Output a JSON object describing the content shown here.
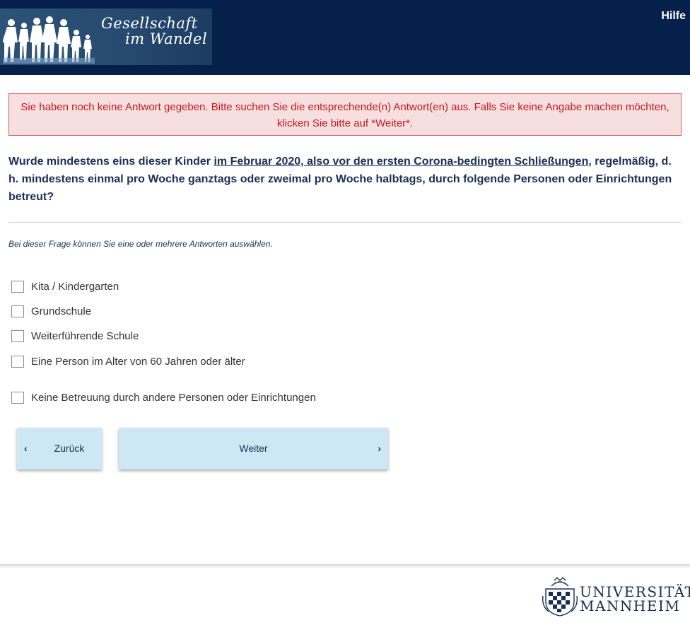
{
  "header": {
    "logo_line1": "Gesellschaft",
    "logo_line2": "im Wandel",
    "help_label": "Hilfe"
  },
  "alert": {
    "message": "Sie haben noch keine Antwort gegeben. Bitte suchen Sie die entsprechende(n) Antwort(en) aus. Falls Sie keine Angabe machen möchten, klicken Sie bitte auf *Weiter*."
  },
  "question": {
    "text_before": "Wurde mindestens eins dieser Kinder ",
    "text_underlined": "im Februar 2020, also vor den ersten Corona-bedingten Schließungen",
    "text_after": ", regelmäßig, d. h. mindestens einmal pro Woche ganztags oder zweimal pro Woche halbtags, durch folgende Personen oder Einrichtungen betreut?",
    "hint": "Bei dieser Frage können Sie eine oder mehrere Antworten auswählen."
  },
  "options": [
    {
      "label": "Kita / Kindergarten",
      "checked": false
    },
    {
      "label": "Grundschule",
      "checked": false
    },
    {
      "label": "Weiterführende Schule",
      "checked": false
    },
    {
      "label": "Eine Person im Alter von 60 Jahren oder älter",
      "checked": false
    },
    {
      "label": "Keine Betreuung durch andere Personen oder Einrichtungen",
      "checked": false
    }
  ],
  "nav": {
    "back_label": "Zurück",
    "next_label": "Weiter"
  },
  "footer": {
    "university_line1": "UNIVERSITÄT",
    "university_line2": "MANNHEIM"
  },
  "colors": {
    "header_bg": "#05204a",
    "alert_bg": "#f7dfe0",
    "alert_text": "#c8181c",
    "question_text": "#1a2f55",
    "button_bg": "#cde7f4"
  }
}
